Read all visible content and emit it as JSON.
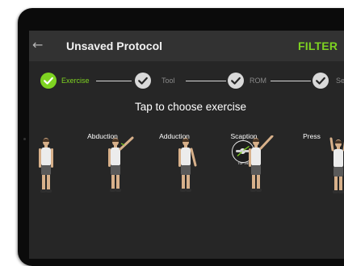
{
  "appbar": {
    "back_icon": "arrow-left-icon",
    "title": "Unsaved Protocol",
    "filter_label": "FILTER"
  },
  "stepper": {
    "steps": [
      {
        "label": "Exercise",
        "state": "active"
      },
      {
        "label": "Tool",
        "state": "pending"
      },
      {
        "label": "ROM",
        "state": "pending"
      },
      {
        "label": "Se",
        "state": "pending"
      }
    ]
  },
  "heading": "Tap to choose exercise",
  "exercises": [
    {
      "label": "",
      "pose": "arms-down"
    },
    {
      "label": "Abduction",
      "pose": "arm-raised-side"
    },
    {
      "label": "Adduction",
      "pose": "arm-down-side"
    },
    {
      "label": "Scaption",
      "pose": "arm-raised-diagonal",
      "badge_caption": "TOP VIEW"
    },
    {
      "label": "Press",
      "pose": "arms-overhead"
    }
  ],
  "colors": {
    "accent_green": "#7ed321",
    "background": "#262626",
    "appbar": "#323232",
    "pending_step": "#d9d9d9"
  }
}
